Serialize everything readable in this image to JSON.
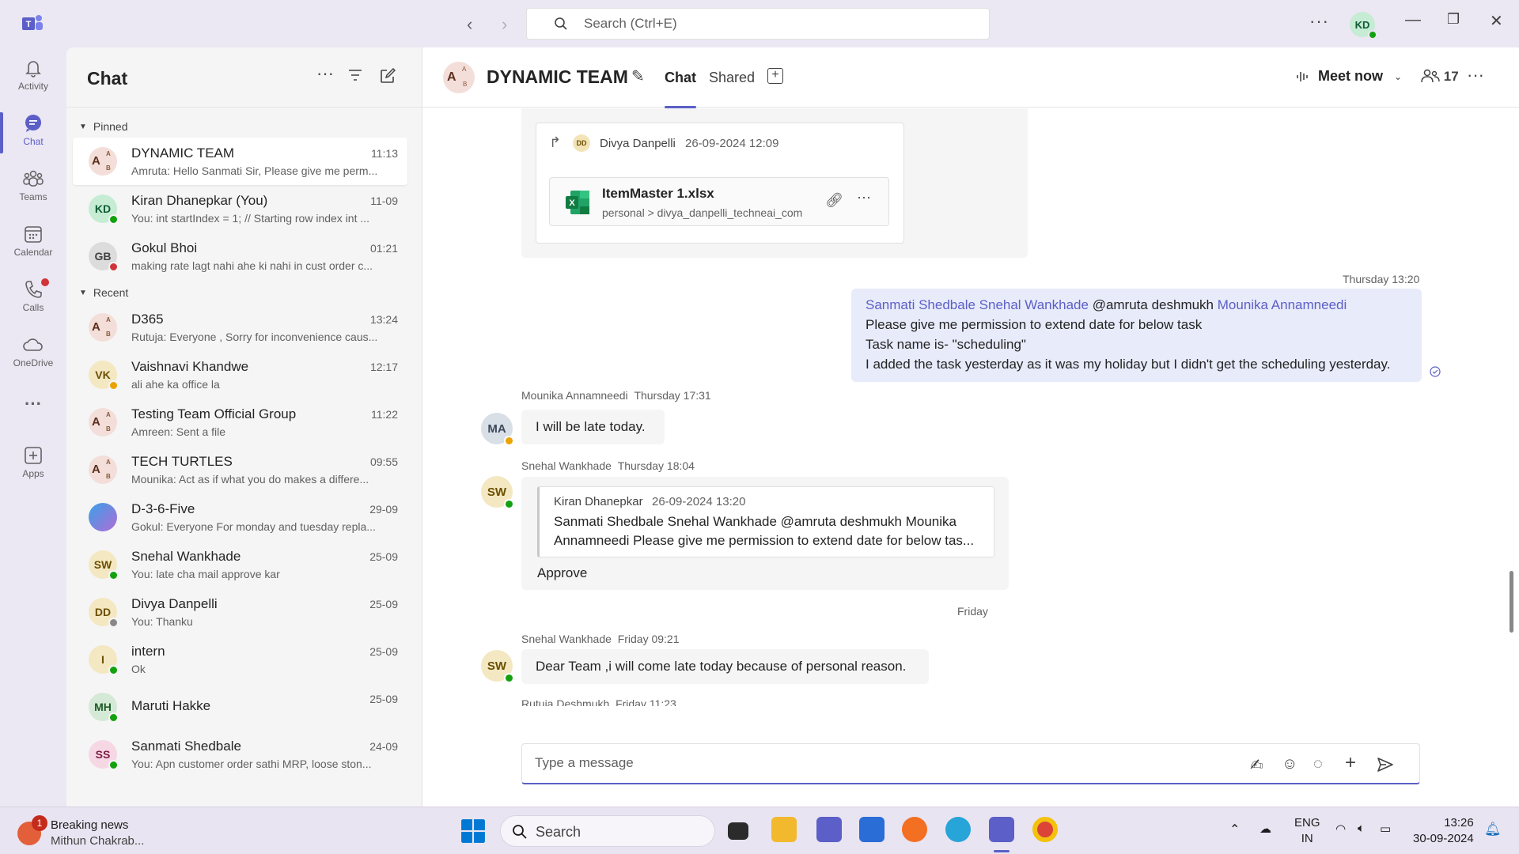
{
  "titlebar": {
    "search_placeholder": "Search (Ctrl+E)",
    "user_initials": "KD"
  },
  "rail": {
    "items": [
      {
        "label": "Activity",
        "icon": "bell-icon"
      },
      {
        "label": "Chat",
        "icon": "chat-icon",
        "active": true
      },
      {
        "label": "Teams",
        "icon": "teams-icon"
      },
      {
        "label": "Calendar",
        "icon": "calendar-icon"
      },
      {
        "label": "Calls",
        "icon": "phone-icon"
      },
      {
        "label": "OneDrive",
        "icon": "cloud-icon"
      },
      {
        "label": "Apps",
        "icon": "apps-icon"
      }
    ]
  },
  "chatlist": {
    "title": "Chat",
    "pinned_label": "Pinned",
    "recent_label": "Recent",
    "pinned": [
      {
        "name": "DYNAMIC TEAM",
        "time": "11:13",
        "preview": "Amruta: Hello Sanmati Sir, Please give me perm...",
        "initials": "A",
        "group": true
      },
      {
        "name": "Kiran Dhanepkar (You)",
        "time": "11-09",
        "preview": "You: int startIndex = 1; // Starting row index int ...",
        "initials": "KD"
      },
      {
        "name": "Gokul Bhoi",
        "time": "01:21",
        "preview": "making rate lagt nahi ahe ki nahi in cust order c...",
        "initials": "GB"
      }
    ],
    "recent": [
      {
        "name": "D365",
        "time": "13:24",
        "preview": "Rutuja: Everyone , Sorry for inconvenience caus...",
        "initials": "A",
        "group": true
      },
      {
        "name": "Vaishnavi Khandwe",
        "time": "12:17",
        "preview": "ali ahe ka office la",
        "initials": "VK"
      },
      {
        "name": "Testing Team Official Group",
        "time": "11:22",
        "preview": "Amreen: Sent a file",
        "initials": "A",
        "group": true
      },
      {
        "name": "TECH TURTLES",
        "time": "09:55",
        "preview": "Mounika: Act as if what you do makes a differe...",
        "initials": "A",
        "group": true
      },
      {
        "name": "D-3-6-Five",
        "time": "29-09",
        "preview": "Gokul: Everyone For monday and tuesday repla...",
        "initials": ""
      },
      {
        "name": "Snehal Wankhade",
        "time": "25-09",
        "preview": "You: late cha mail approve kar",
        "initials": "SW"
      },
      {
        "name": "Divya Danpelli",
        "time": "25-09",
        "preview": "You: Thanku",
        "initials": "DD"
      },
      {
        "name": "intern",
        "time": "25-09",
        "preview": "Ok",
        "initials": "I"
      },
      {
        "name": "Maruti Hakke",
        "time": "25-09",
        "preview": "",
        "initials": "MH"
      },
      {
        "name": "Sanmati Shedbale",
        "time": "24-09",
        "preview": "You: Apn customer order sathi MRP, loose ston...",
        "initials": "SS"
      }
    ]
  },
  "main": {
    "title": "DYNAMIC TEAM",
    "tabs": [
      "Chat",
      "Shared"
    ],
    "meet_now": "Meet now",
    "participants": "17",
    "forward": {
      "author_initials": "DD",
      "author": "Divya Danpelli",
      "time": "26-09-2024 12:09",
      "file_name": "ItemMaster 1.xlsx",
      "file_path": "personal > divya_danpelli_techneai_com"
    },
    "my_msg": {
      "time": "Thursday 13:20",
      "mention1": "Sanmati Shedbale Snehal Wankhade",
      "mention_text": "@amruta deshmukh",
      "mention2": "Mounika Annamneedi",
      "line2": "Please give me permission to extend date for below task",
      "line3": "Task name is- \"scheduling\"",
      "line4": "I added the task yesterday as it was my holiday but I didn't get the scheduling yesterday."
    },
    "msg1": {
      "author": "Mounika Annamneedi",
      "time": "Thursday 17:31",
      "text": "I will be late today.",
      "initials": "MA"
    },
    "msg2": {
      "author": "Snehal Wankhade",
      "time": "Thursday 18:04",
      "initials": "SW",
      "quote_author": "Kiran Dhanepkar",
      "quote_time": "26-09-2024 13:20",
      "quote_line1": "Sanmati Shedbale Snehal Wankhade @amruta deshmukh Mounika",
      "quote_line2": "Annamneedi Please give me permission to extend date for below tas...",
      "text": "Approve"
    },
    "day_divider": "Friday",
    "msg3": {
      "author": "Snehal Wankhade",
      "time": "Friday 09:21",
      "text": "Dear Team ,i will come late today because of personal reason.",
      "initials": "SW"
    },
    "msg4": {
      "author": "Rutuja Deshmukh",
      "time": "Friday 11:23"
    },
    "composer_placeholder": "Type a message"
  },
  "taskbar": {
    "news_title": "Breaking news",
    "news_sub": "Mithun Chakrab...",
    "news_badge": "1",
    "search_label": "Search",
    "lang1": "ENG",
    "lang2": "IN",
    "time": "13:26",
    "date": "30-09-2024"
  },
  "colors": {
    "accent": "#5b5fc7",
    "available": "#13a10e",
    "busy": "#d13438",
    "away": "#eaa300"
  }
}
